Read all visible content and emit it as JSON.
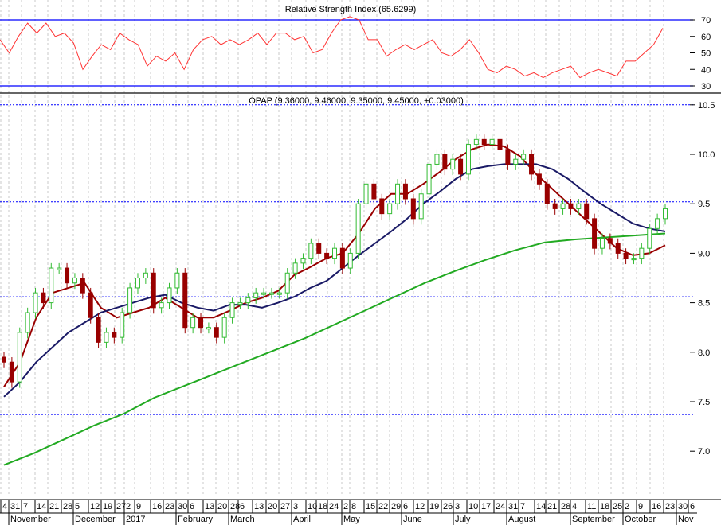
{
  "chart_data": [
    {
      "type": "line",
      "title": "Relative Strength Index (65.6299)",
      "ylim": [
        30,
        70
      ],
      "yticks": [
        70,
        60,
        50,
        40,
        30
      ],
      "levels": [
        70,
        30
      ],
      "series": [
        {
          "name": "RSI",
          "color": "#ff3333",
          "values": [
            58,
            50,
            60,
            68,
            62,
            68,
            60,
            62,
            56,
            40,
            48,
            55,
            52,
            62,
            58,
            55,
            42,
            48,
            45,
            50,
            40,
            52,
            58,
            60,
            55,
            58,
            55,
            58,
            62,
            55,
            62,
            62,
            58,
            60,
            50,
            52,
            62,
            70,
            72,
            70,
            58,
            58,
            48,
            52,
            55,
            52,
            55,
            58,
            50,
            48,
            52,
            58,
            50,
            40,
            38,
            42,
            40,
            36,
            38,
            35,
            38,
            40,
            42,
            35,
            38,
            40,
            38,
            36,
            45,
            45,
            50,
            55,
            65
          ]
        }
      ]
    },
    {
      "type": "candlestick",
      "title": "OPAP (9.36000, 9.46000, 9.35000, 9.45000, +0.03000)",
      "ylim": [
        6.6,
        10.6
      ],
      "yticks": [
        10.5,
        10.0,
        9.5,
        9.0,
        8.5,
        8.0,
        7.5,
        7.0
      ],
      "levels": [
        10.5,
        9.52,
        8.56,
        7.37
      ],
      "close": [
        7.9,
        7.7,
        8.2,
        8.4,
        8.6,
        8.5,
        8.85,
        8.85,
        8.7,
        8.75,
        8.6,
        8.35,
        8.1,
        8.2,
        8.15,
        8.4,
        8.65,
        8.75,
        8.8,
        8.45,
        8.5,
        8.65,
        8.8,
        8.25,
        8.35,
        8.25,
        8.25,
        8.15,
        8.35,
        8.5,
        8.5,
        8.55,
        8.6,
        8.6,
        8.6,
        8.6,
        8.8,
        8.9,
        8.95,
        9.1,
        9.0,
        8.95,
        9.05,
        8.85,
        9.0,
        9.5,
        9.7,
        9.55,
        9.4,
        9.5,
        9.7,
        9.55,
        9.35,
        9.6,
        9.9,
        10.0,
        9.85,
        9.95,
        9.8,
        10.1,
        10.15,
        10.1,
        10.15,
        10.05,
        9.9,
        9.95,
        10.0,
        9.8,
        9.7,
        9.5,
        9.45,
        9.5,
        9.45,
        9.5,
        9.35,
        9.05,
        9.15,
        9.1,
        9.0,
        8.95,
        8.95,
        9.05,
        9.25,
        9.35,
        9.45
      ],
      "moving_averages": [
        {
          "name": "short MA",
          "color": "#990000",
          "values": [
            7.65,
            7.9,
            8.35,
            8.6,
            8.65,
            8.7,
            8.45,
            8.35,
            8.4,
            8.45,
            8.55,
            8.45,
            8.35,
            8.35,
            8.42,
            8.5,
            8.55,
            8.62,
            8.78,
            8.86,
            8.95,
            9.0,
            9.2,
            9.45,
            9.6,
            9.6,
            9.7,
            9.82,
            9.95,
            10.05,
            10.1,
            10.08,
            9.98,
            9.8,
            9.65,
            9.5,
            9.35,
            9.2,
            9.05,
            8.98,
            9.0,
            9.08
          ]
        },
        {
          "name": "medium MA",
          "color": "#1a1a66",
          "values": [
            7.55,
            7.7,
            7.9,
            8.05,
            8.2,
            8.3,
            8.4,
            8.45,
            8.5,
            8.55,
            8.58,
            8.5,
            8.45,
            8.42,
            8.48,
            8.48,
            8.45,
            8.5,
            8.56,
            8.65,
            8.72,
            8.85,
            8.98,
            9.1,
            9.22,
            9.35,
            9.5,
            9.62,
            9.75,
            9.85,
            9.88,
            9.9,
            9.9,
            9.9,
            9.85,
            9.75,
            9.62,
            9.5,
            9.4,
            9.3,
            9.25,
            9.22
          ]
        },
        {
          "name": "long MA",
          "color": "#22aa22",
          "values": [
            6.86,
            6.98,
            7.12,
            7.26,
            7.38,
            7.54,
            7.66,
            7.78,
            7.9,
            8.02,
            8.14,
            8.28,
            8.42,
            8.56,
            8.7,
            8.82,
            8.93,
            9.03,
            9.11,
            9.14,
            9.16,
            9.18,
            9.2
          ]
        }
      ]
    }
  ],
  "x_axis": {
    "day_labels": [
      "4",
      "31",
      "7",
      "14",
      "21",
      "28",
      "5",
      "12",
      "19",
      "27",
      "2",
      "9",
      "16",
      "23",
      "30",
      "6",
      "13",
      "20",
      "28",
      "6",
      "13",
      "20",
      "27",
      "3",
      "10",
      "18",
      "24",
      "2",
      "8",
      "15",
      "22",
      "29",
      "6",
      "12",
      "19",
      "26",
      "3",
      "10",
      "17",
      "24",
      "31",
      "7",
      "14",
      "21",
      "28",
      "4",
      "11",
      "18",
      "25",
      "2",
      "9",
      "16",
      "23",
      "30",
      "6"
    ],
    "month_labels": [
      "November",
      "December",
      "2017",
      "February",
      "March",
      "April",
      "May",
      "June",
      "July",
      "August",
      "September",
      "October",
      "Nov"
    ]
  },
  "colors": {
    "level_line": "#0000ff",
    "up": "#33bb33",
    "down": "#990000",
    "grid": "#c8c8c8"
  }
}
